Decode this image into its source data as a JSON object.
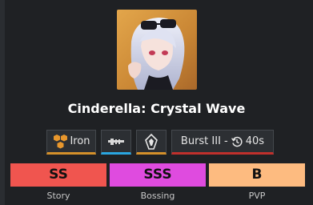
{
  "character": {
    "name": "Cinderella: Crystal Wave"
  },
  "tags": {
    "element": {
      "label": "Iron",
      "icon": "iron-hexagons-icon",
      "accent": "#d4902a"
    },
    "weapon": {
      "icon": "rifle-icon",
      "accent": "#2aa6e0"
    },
    "class": {
      "icon": "attacker-class-icon",
      "accent": "#d4902a"
    },
    "burst": {
      "label": "Burst III - ",
      "cooldown": "40s",
      "icon": "cooldown-clock-icon",
      "accent": "#c0302c"
    }
  },
  "ratings": [
    {
      "tier": "SS",
      "label": "Story",
      "color": "#f0554f"
    },
    {
      "tier": "SSS",
      "label": "Bossing",
      "color": "#df4bdf"
    },
    {
      "tier": "B",
      "label": "PVP",
      "color": "#fdbb80"
    }
  ]
}
